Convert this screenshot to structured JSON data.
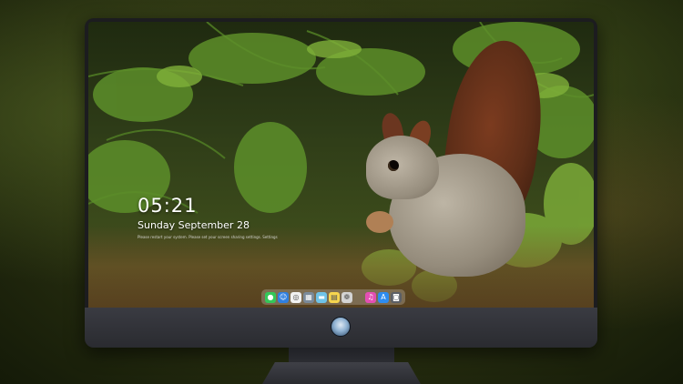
{
  "lock_screen": {
    "time": "05:21",
    "date": "Sunday September  28",
    "hint": "Please restart your system. Please set your screen sharing settings. Settings"
  },
  "dock": {
    "items": [
      {
        "name": "messages-icon",
        "color": "#34c759",
        "glyph": "●"
      },
      {
        "name": "finder-icon",
        "color": "#2f7fe0",
        "glyph": "☺"
      },
      {
        "name": "safari-icon",
        "color": "#f2f2f2",
        "glyph": "◎"
      },
      {
        "name": "launchpad-icon",
        "color": "#7a8a9a",
        "glyph": "▦"
      },
      {
        "name": "folder-icon",
        "color": "#6fc3e8",
        "glyph": "▬"
      },
      {
        "name": "notes-icon",
        "color": "#f6d54e",
        "glyph": "▤"
      },
      {
        "name": "photos-icon",
        "color": "#d4d4d4",
        "glyph": "❁"
      },
      {
        "name": "itunes-icon",
        "color": "#e34fb3",
        "glyph": "♫"
      },
      {
        "name": "app-store-icon",
        "color": "#2d8cf0",
        "glyph": "A"
      },
      {
        "name": "camera-icon",
        "color": "#5b5f66",
        "glyph": "◙"
      }
    ]
  }
}
